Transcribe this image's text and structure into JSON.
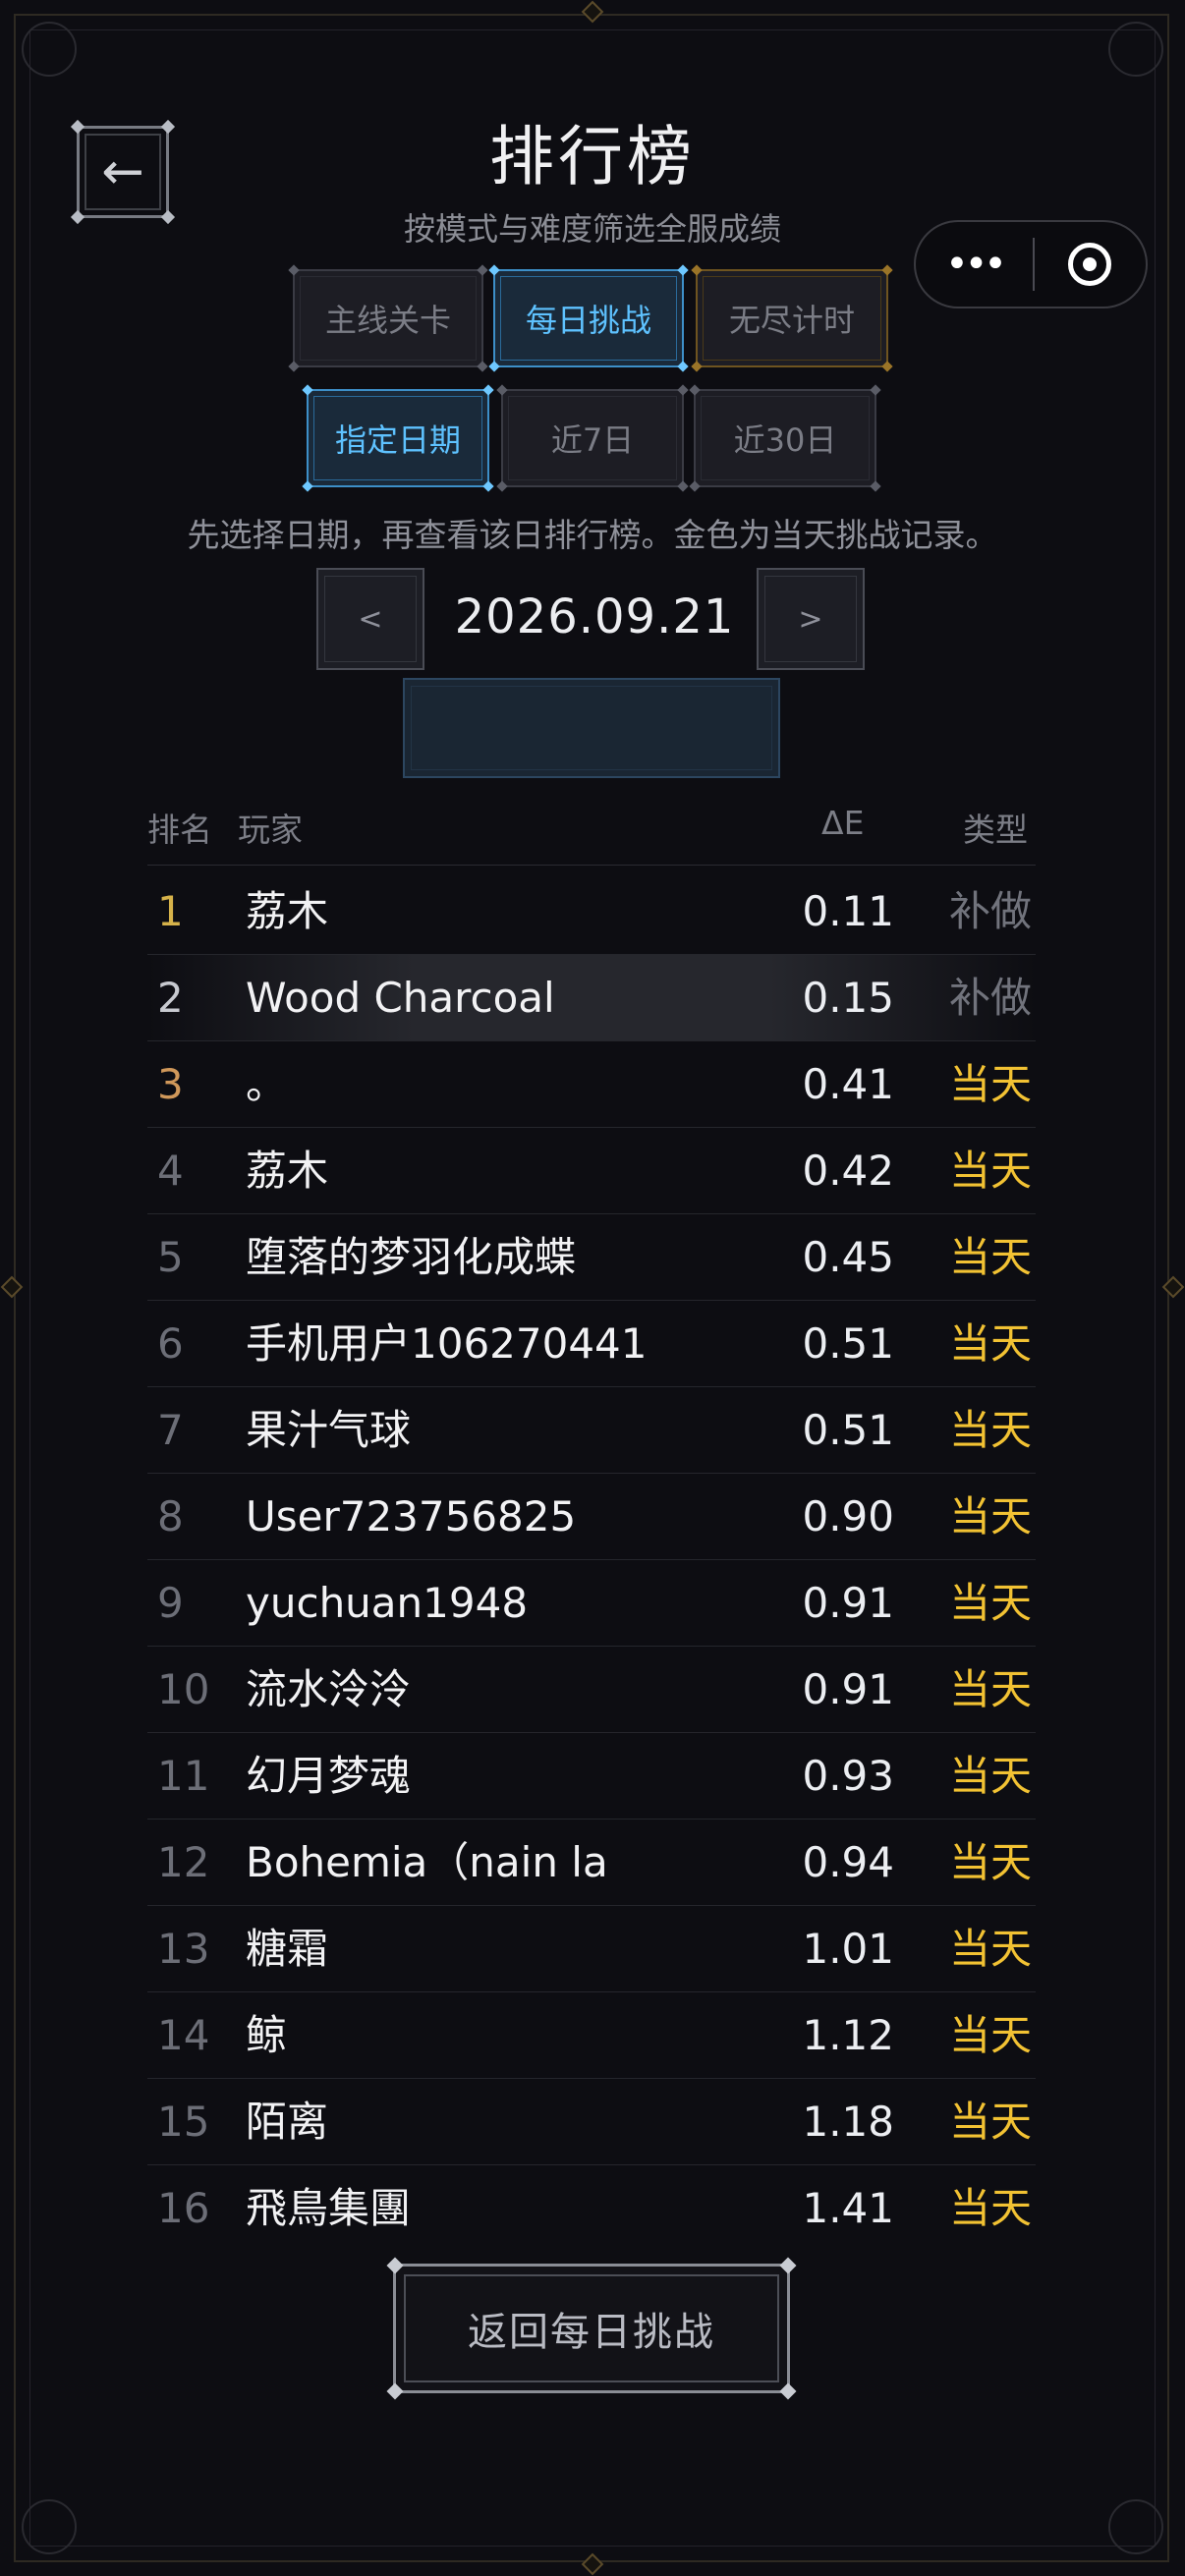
{
  "header": {
    "title": "排行榜",
    "subtitle": "按模式与难度筛选全服成绩",
    "back_icon": "←"
  },
  "mini_capsule": {
    "more_icon": "•••",
    "close_icon": "target-ring"
  },
  "mode_tabs": [
    {
      "label": "主线关卡",
      "active": false
    },
    {
      "label": "每日挑战",
      "active": true
    },
    {
      "label": "无尽计时",
      "active": false
    }
  ],
  "range_tabs": [
    {
      "label": "指定日期",
      "active": true
    },
    {
      "label": "近7日",
      "active": false
    },
    {
      "label": "近30日",
      "active": false
    }
  ],
  "hint": "先选择日期，再查看该日排行榜。金色为当天挑战记录。",
  "date_nav": {
    "prev_label": "<",
    "date": "2026.09.21",
    "next_label": ">"
  },
  "table": {
    "headers": {
      "rank": "排名",
      "player": "玩家",
      "de": "ΔE",
      "type": "类型"
    },
    "rows": [
      {
        "rank": "1",
        "name": "荔木",
        "de": "0.11",
        "type": "补做"
      },
      {
        "rank": "2",
        "name": "Wood Charcoal",
        "de": "0.15",
        "type": "补做"
      },
      {
        "rank": "3",
        "name": "。",
        "de": "0.41",
        "type": "当天"
      },
      {
        "rank": "4",
        "name": "荔木",
        "de": "0.42",
        "type": "当天"
      },
      {
        "rank": "5",
        "name": "堕落的梦羽化成蝶",
        "de": "0.45",
        "type": "当天"
      },
      {
        "rank": "6",
        "name": "手机用户106270441",
        "de": "0.51",
        "type": "当天"
      },
      {
        "rank": "7",
        "name": "果汁气球",
        "de": "0.51",
        "type": "当天"
      },
      {
        "rank": "8",
        "name": "User723756825",
        "de": "0.90",
        "type": "当天"
      },
      {
        "rank": "9",
        "name": "yuchuan1948",
        "de": "0.91",
        "type": "当天"
      },
      {
        "rank": "10",
        "name": "流水泠泠",
        "de": "0.91",
        "type": "当天"
      },
      {
        "rank": "11",
        "name": "幻月梦魂",
        "de": "0.93",
        "type": "当天"
      },
      {
        "rank": "12",
        "name": "Bohemia（nain la",
        "de": "0.94",
        "type": "当天"
      },
      {
        "rank": "13",
        "name": "糖霜",
        "de": "1.01",
        "type": "当天"
      },
      {
        "rank": "14",
        "name": "鲸",
        "de": "1.12",
        "type": "当天"
      },
      {
        "rank": "15",
        "name": "陌离",
        "de": "1.18",
        "type": "当天"
      },
      {
        "rank": "16",
        "name": "飛鳥集團",
        "de": "1.41",
        "type": "当天"
      }
    ]
  },
  "return_button": "返回每日挑战",
  "colors": {
    "accent_blue": "#5ec2ff",
    "gold": "#f2c233",
    "background": "#0d0d12"
  }
}
